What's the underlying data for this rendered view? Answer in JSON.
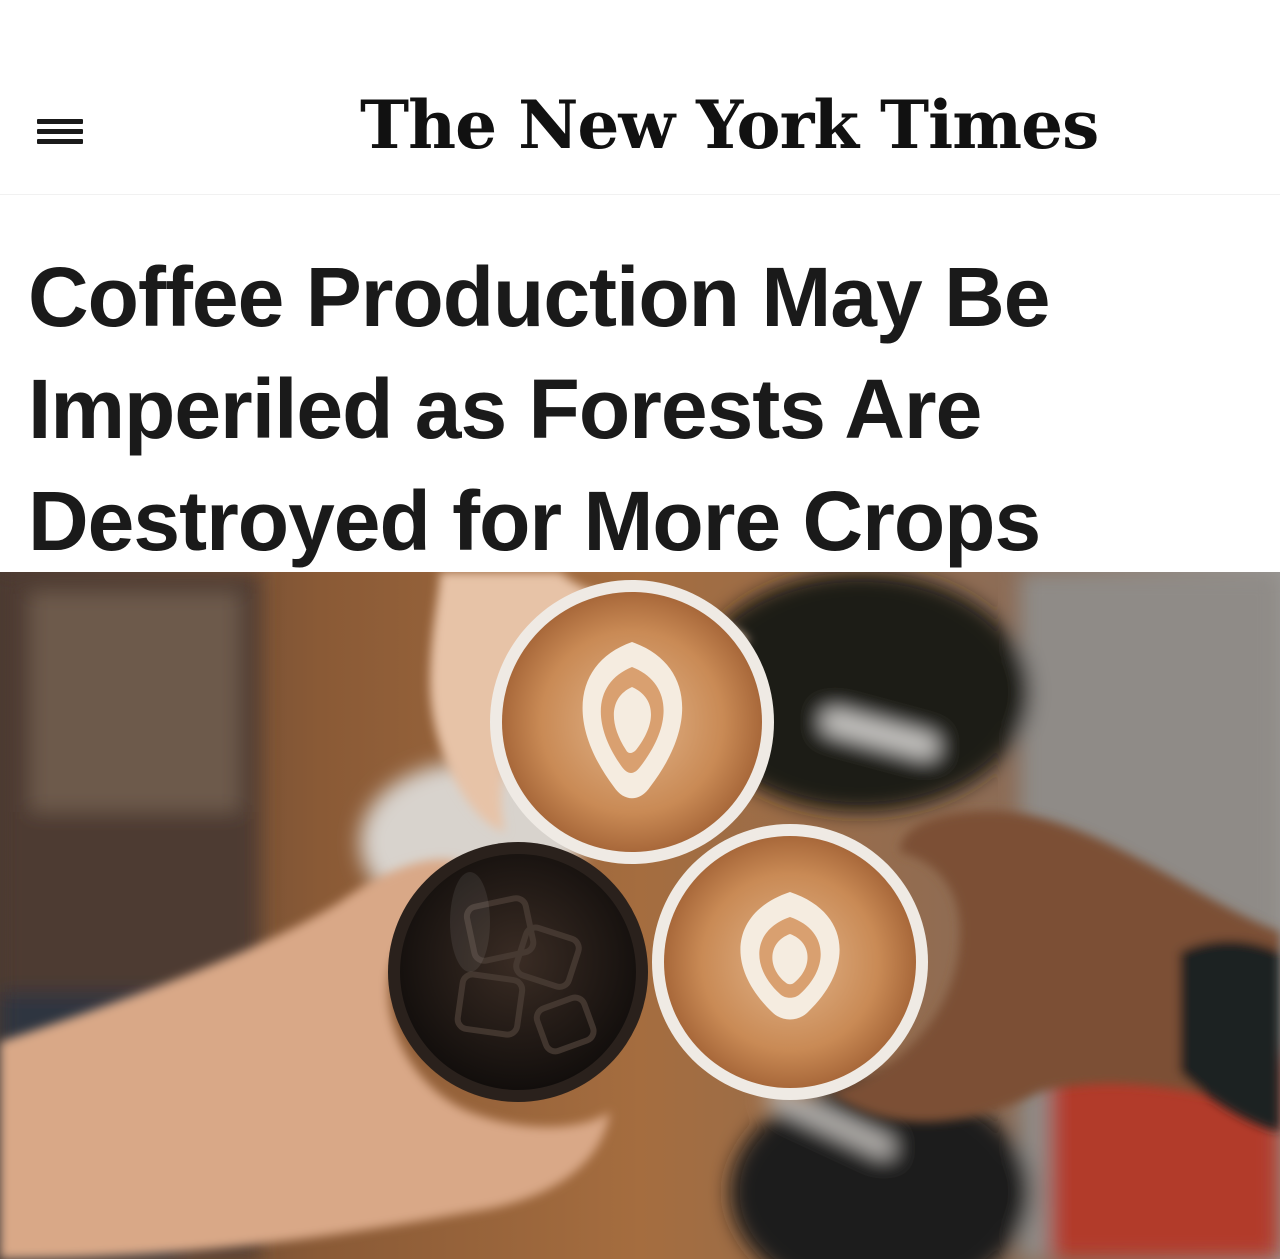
{
  "header": {
    "logo_text": "The New York Times",
    "menu_icon": "hamburger-menu-icon"
  },
  "article": {
    "headline_lines": [
      "Coffee Production May Be",
      "Imperiled as Forests Are",
      "Destroyed for More Crops"
    ]
  },
  "hero_image": {
    "subject": "three hands toasting two latte art cups and an iced black coffee over a wooden table",
    "colors": {
      "table": "#a86c3a",
      "crema": "#c98a55",
      "foam": "#f5ece0",
      "iced_coffee": "#1b1613",
      "background_left": "#5a4436",
      "background_right": "#8d8a86"
    }
  }
}
